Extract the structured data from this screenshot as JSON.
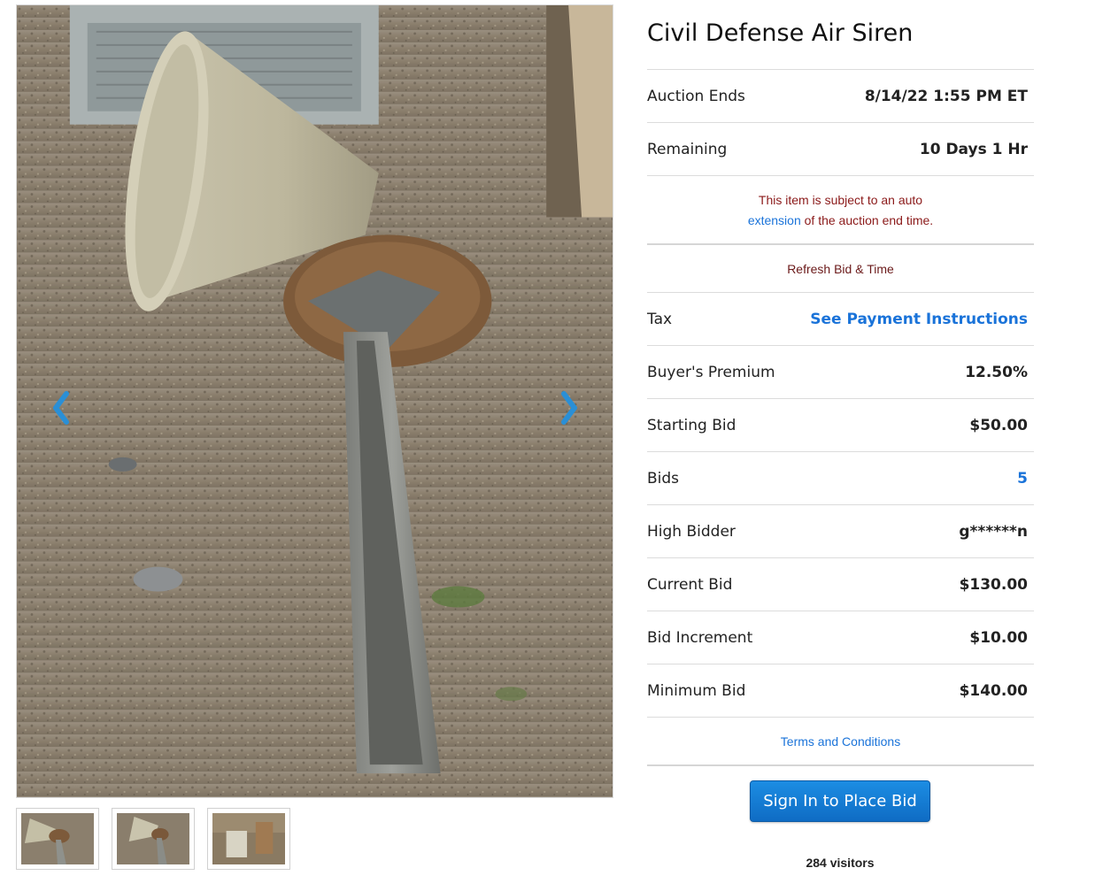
{
  "item": {
    "title": "Civil Defense Air Siren"
  },
  "gallery": {
    "main_image": "siren-photo",
    "prev_icon": "chevron-left-icon",
    "next_icon": "chevron-right-icon",
    "thumbnails": [
      "thumb-1",
      "thumb-2",
      "thumb-3"
    ]
  },
  "details": {
    "auction_ends": {
      "label": "Auction Ends",
      "value": "8/14/22 1:55 PM ET"
    },
    "remaining": {
      "label": "Remaining",
      "value": "10 Days 1 Hr"
    },
    "notice": {
      "line1": "This item is subject to an auto",
      "link": "extension",
      "line2": " of the auction end time."
    },
    "refresh_label": "Refresh Bid & Time",
    "tax": {
      "label": "Tax",
      "value": "See Payment Instructions"
    },
    "buyers_premium": {
      "label": "Buyer's Premium",
      "value": "12.50%"
    },
    "starting_bid": {
      "label": "Starting Bid",
      "value": "$50.00"
    },
    "bids": {
      "label": "Bids",
      "value": "5"
    },
    "high_bidder": {
      "label": "High Bidder",
      "value": "g******n"
    },
    "current_bid": {
      "label": "Current Bid",
      "value": "$130.00"
    },
    "bid_increment": {
      "label": "Bid Increment",
      "value": "$10.00"
    },
    "minimum_bid": {
      "label": "Minimum Bid",
      "value": "$140.00"
    },
    "terms_label": "Terms and Conditions"
  },
  "actions": {
    "sign_in_label": "Sign In to Place Bid",
    "visitors": "284 visitors"
  },
  "colors": {
    "accent": "#1a73d9",
    "notice": "#8b1a1a",
    "button": "#1c8de3"
  }
}
